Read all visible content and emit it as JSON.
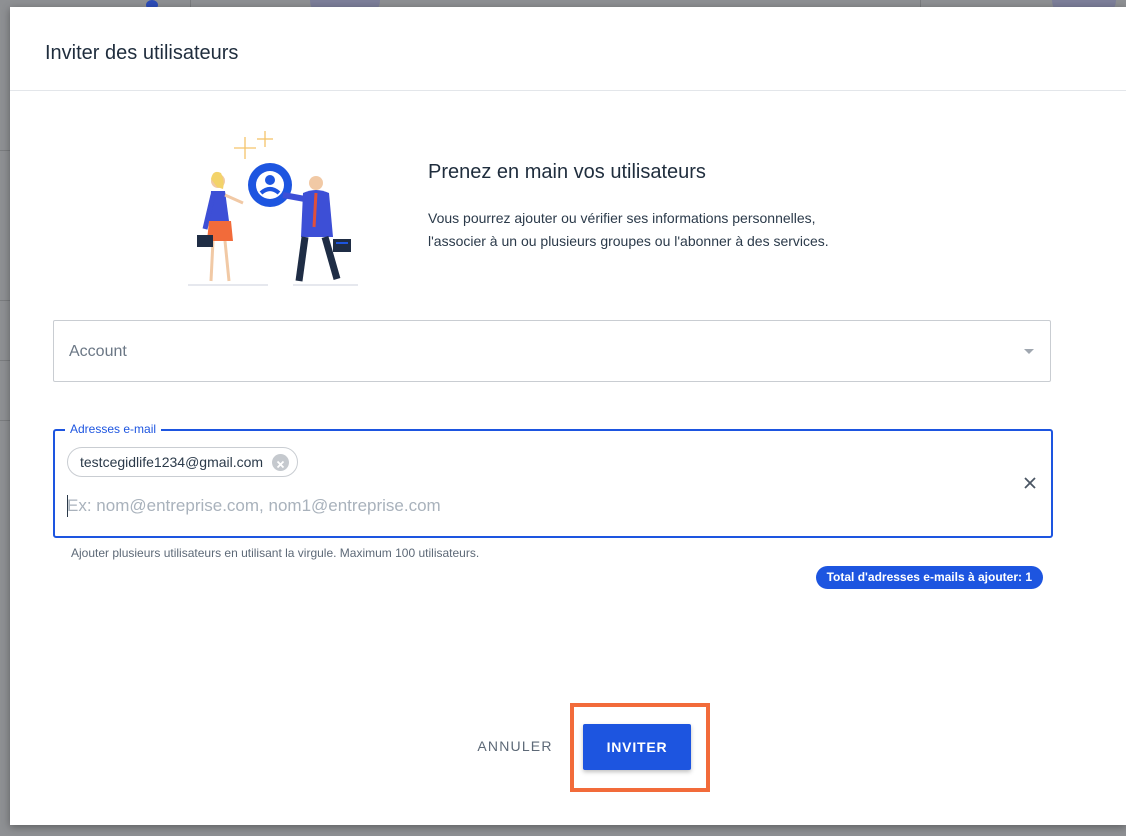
{
  "dialog": {
    "title": "Inviter des utilisateurs",
    "hero_heading": "Prenez en main vos utilisateurs",
    "hero_line1": "Vous pourrez ajouter ou vérifier ses informations personnelles,",
    "hero_line2": "l'associer à un ou plusieurs groupes ou l'abonner à des services.",
    "illustration_icon": "users-handshake-illustration"
  },
  "account_select": {
    "placeholder": "Account"
  },
  "emails": {
    "legend": "Adresses e-mail",
    "chips": [
      "testcegidlife1234@gmail.com"
    ],
    "input_value": "",
    "input_placeholder": "Ex: nom@entreprise.com, nom1@entreprise.com",
    "helper": "Ajouter plusieurs utilisateurs en utilisant la virgule. Maximum 100 utilisateurs.",
    "count_label": "Total d'adresses e-mails à ajouter: 1"
  },
  "actions": {
    "cancel_label": "ANNULER",
    "invite_label": "INVITER"
  },
  "colors": {
    "primary": "#1d55e0",
    "highlight": "#f26b3a"
  }
}
